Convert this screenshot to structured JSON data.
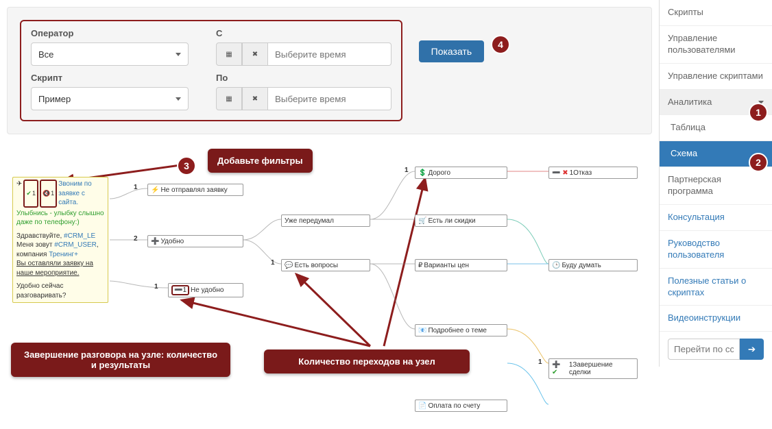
{
  "filters": {
    "operator_label": "Оператор",
    "operator_value": "Все",
    "script_label": "Скрипт",
    "script_value": "Пример",
    "from_label": "С",
    "to_label": "По",
    "time_placeholder": "Выберите время",
    "show_label": "Показать"
  },
  "callouts": {
    "add_filters": "Добавьте фильтры",
    "node_end": "Завершение разговора на узле: количество и результаты",
    "transitions": "Количество переходов на узел"
  },
  "badges": {
    "b1": "1",
    "b2": "2",
    "b3": "3",
    "b4": "4"
  },
  "menu": {
    "scripts": "Скрипты",
    "users": "Управление пользователями",
    "manage_scripts": "Управление скриптами",
    "analytics": "Аналитика",
    "table": "Таблица",
    "scheme": "Схема",
    "partner": "Партнерская программа",
    "consult": "Консультация",
    "guide": "Руководство пользователя",
    "articles": "Полезные статьи о скриптах",
    "video": "Видеоинструкции",
    "goto_placeholder": "Перейти по сс"
  },
  "script_card": {
    "badge_v": "1",
    "badge_s": "1",
    "title": "Звоним по заявке с сайта.",
    "line1": "Улыбнись - улыбку слышно даже по телефону:)",
    "hello": "Здравствуйте, ",
    "crm_lead": "#CRM_LE",
    "me": "Меня зовут ",
    "crm_user": "#CRM_USER",
    "comma": ",",
    "company": "компания ",
    "training": "Тренинг+",
    "left": "Вы оставляли заявку на наше мероприятие.",
    "ask": "Удобно сейчас разговаривать?"
  },
  "nodes": {
    "n_sent": "Не отправлял заявку",
    "n_udobno": "Удобно",
    "n_neudobno": "Не удобно",
    "n_peredumal": "Уже передумал",
    "n_voprosy": "Есть вопросы",
    "n_dorogo": "Дорого",
    "n_skidki": "Есть ли скидки",
    "n_varianty": "Варианты цен",
    "n_podrobnee": "Подробнее о теме",
    "n_otkaz": "1Отказ",
    "n_dumat": "Буду думать",
    "n_zaversh": "1Завершение сделки",
    "n_oplata": "Оплата по счету",
    "c1": "1",
    "c2": "2"
  }
}
